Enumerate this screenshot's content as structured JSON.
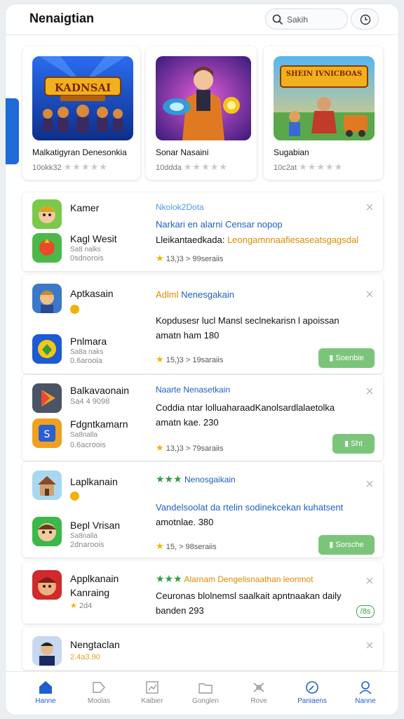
{
  "header": {
    "title": "Nenaigtian",
    "search_placeholder": "Sakih"
  },
  "featured": [
    {
      "art_title": "KADNSAI",
      "name": "Malkatigyran Denesonkia",
      "meta": "10okk32",
      "rating": 0
    },
    {
      "art_title": "",
      "name": "Sonar Nasaini",
      "meta": "10ddda",
      "rating": 0
    },
    {
      "art_title": "SHEIN IVNICBOAS",
      "name": "Sugabian",
      "meta": "10c2at",
      "rating": 0
    }
  ],
  "cards": [
    {
      "apps": [
        {
          "name": "Kamer",
          "sub": ""
        },
        {
          "name": "Kagl Wesit",
          "sub": "Sa8 nalks",
          "sub2": "0sdnorois"
        }
      ],
      "head": "Nkolok2Dota",
      "line1": "Narkari en alarni Censar nopop",
      "line2_a": "Lleikantaedkada:",
      "line2_b": "Leongamnnaafiesaseatsgagsdal",
      "rating": "13,)3 > 99seraiis",
      "button": ""
    },
    {
      "apps": [
        {
          "name": "Aptkasain",
          "sub": ""
        },
        {
          "name": "Pnlmara",
          "sub": "Sa8a naks",
          "sub2": "0.6arooia"
        }
      ],
      "head_a": "Adlml",
      "head_b": "Nenesgakain",
      "line1": "Kopdusesr lucl Mansl seclnekarisn l apoissan",
      "line2": "amatn ham 180",
      "rating": "15,)3 > 19saraiis",
      "button": "Soenbie"
    },
    {
      "apps": [
        {
          "name": "Balkavaonain",
          "sub": "Sa4 4 9098"
        },
        {
          "name": "Fdgntkamarn",
          "sub": "Sa8nalla",
          "sub2": "0.6acroois"
        }
      ],
      "head": "Naarte Nenasetkain",
      "line1": "Coddia ntar lolluaharaadKanolsardlalaetolka",
      "line2": "amatn kae. 230",
      "rating": "13,)3 > 79saraiis",
      "button": "Sht"
    },
    {
      "apps": [
        {
          "name": "Laplkanain",
          "sub": ""
        },
        {
          "name": "Bepl Vrisan",
          "sub": "Sa8nalla",
          "sub2": "2dnaroois"
        }
      ],
      "head": "Nenosgaikain",
      "line1": "Vandelsoolat da rtelin sodinekcekan kuhatsent",
      "line2": "amotnlae. 380",
      "rating": "15, > 98seraiis",
      "button": "Sorsche"
    },
    {
      "apps": [
        {
          "name": "Applkanain",
          "sub": ""
        },
        {
          "name": "Kanraing",
          "sub": "2d4"
        }
      ],
      "head": "Alarnam Dengelisnaathan leonmot",
      "line1": "Ceuronas blolnemsl saalkait apntnaakan daily",
      "line2": "banden 293",
      "rating": "",
      "button": "/8s"
    },
    {
      "apps": [
        {
          "name": "Nengtaclan",
          "sub": "2.4a3.90"
        }
      ]
    }
  ],
  "nav": [
    {
      "label": "Hanne",
      "icon": "home-icon",
      "active": true
    },
    {
      "label": "Moolas",
      "icon": "tag-icon",
      "active": false
    },
    {
      "label": "Kaibier",
      "icon": "chart-icon",
      "active": false
    },
    {
      "label": "Gonglen",
      "icon": "folder-icon",
      "active": false
    },
    {
      "label": "Rove",
      "icon": "puzzle-icon",
      "active": false
    },
    {
      "label": "Paniaens",
      "icon": "compass-icon",
      "active": true
    },
    {
      "label": "Nanne",
      "icon": "user-icon",
      "active": true
    }
  ],
  "colors": {
    "accent": "#1e6ad6",
    "link": "#1f5fbf",
    "orange": "#e08a00",
    "green": "#2f9e44",
    "button": "#7bc57a",
    "star": "#f0b400"
  }
}
